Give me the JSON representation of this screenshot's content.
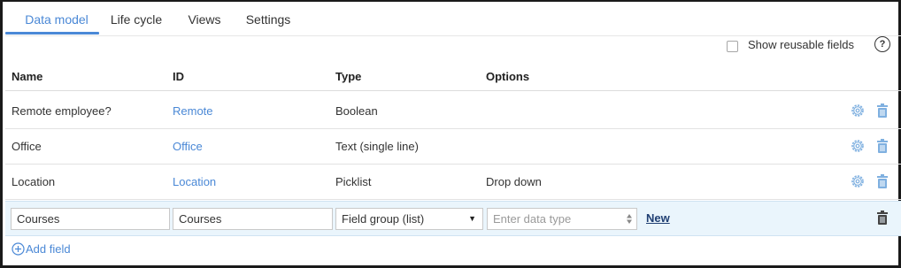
{
  "tabs": [
    {
      "label": "Data model",
      "active": true
    },
    {
      "label": "Life cycle",
      "active": false
    },
    {
      "label": "Views",
      "active": false
    },
    {
      "label": "Settings",
      "active": false
    }
  ],
  "reusable": {
    "label": "Show reusable fields",
    "checked": false,
    "help_symbol": "?"
  },
  "columns": {
    "name": "Name",
    "id": "ID",
    "type": "Type",
    "options": "Options"
  },
  "rows": [
    {
      "name": "Remote employee?",
      "id": "Remote",
      "type": "Boolean",
      "options": ""
    },
    {
      "name": "Office",
      "id": "Office",
      "type": "Text (single line)",
      "options": ""
    },
    {
      "name": "Location",
      "id": "Location",
      "type": "Picklist",
      "options": "Drop down"
    }
  ],
  "edit_row": {
    "name_value": "Courses",
    "id_value": "Courses",
    "type_value": "Field group (list)",
    "data_type_placeholder": "Enter data type",
    "new_label": "New"
  },
  "add_field_label": "Add field",
  "colors": {
    "accent": "#4a88d6",
    "edit_row_bg": "#eaf5fc",
    "icon_blue": "#7fb0e0"
  }
}
